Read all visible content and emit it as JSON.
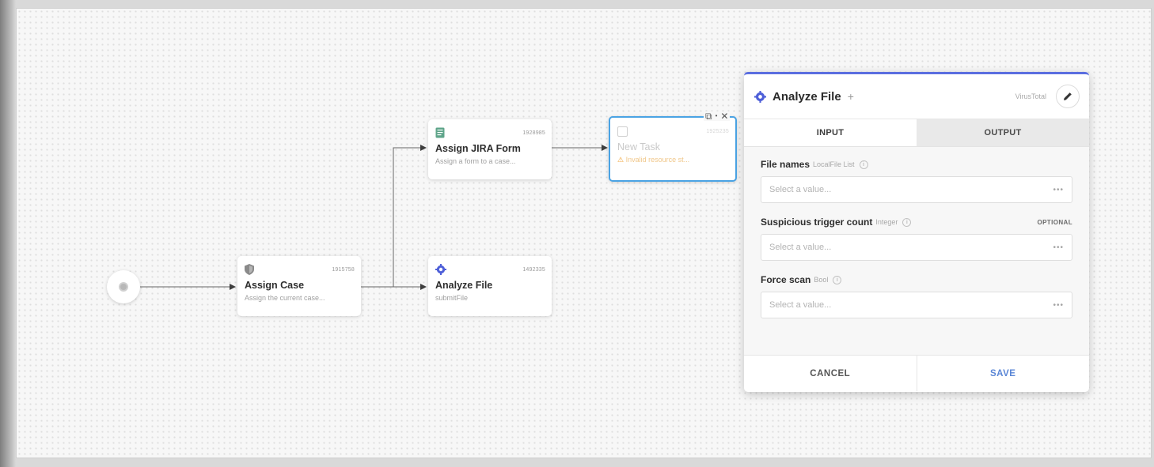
{
  "nodes": {
    "assign_case": {
      "id": "1915758",
      "title": "Assign Case",
      "desc": "Assign the current case..."
    },
    "assign_jira": {
      "id": "1928985",
      "title": "Assign JIRA Form",
      "desc": "Assign a form to a case..."
    },
    "analyze_file": {
      "id": "1492335",
      "title": "Analyze File",
      "desc": "submitFile"
    },
    "new_task": {
      "id": "1925235",
      "title": "New Task",
      "warning": "Invalid resource st..."
    }
  },
  "panel": {
    "title": "Analyze File",
    "vendor": "VirusTotal",
    "tabs": [
      {
        "label": "INPUT"
      },
      {
        "label": "OUTPUT"
      }
    ],
    "fields": [
      {
        "label": "File names",
        "type": "LocalFile List",
        "placeholder": "Select a value...",
        "optional": ""
      },
      {
        "label": "Suspicious trigger count",
        "type": "Integer",
        "placeholder": "Select a value...",
        "optional": "OPTIONAL"
      },
      {
        "label": "Force scan",
        "type": "Bool",
        "placeholder": "Select a value...",
        "optional": ""
      }
    ],
    "cancel_label": "CANCEL",
    "save_label": "SAVE"
  },
  "colors": {
    "accent": "#5b6ee0",
    "selected_border": "#4aa3e4",
    "warning": "#f0a030",
    "save": "#5a86d6"
  }
}
